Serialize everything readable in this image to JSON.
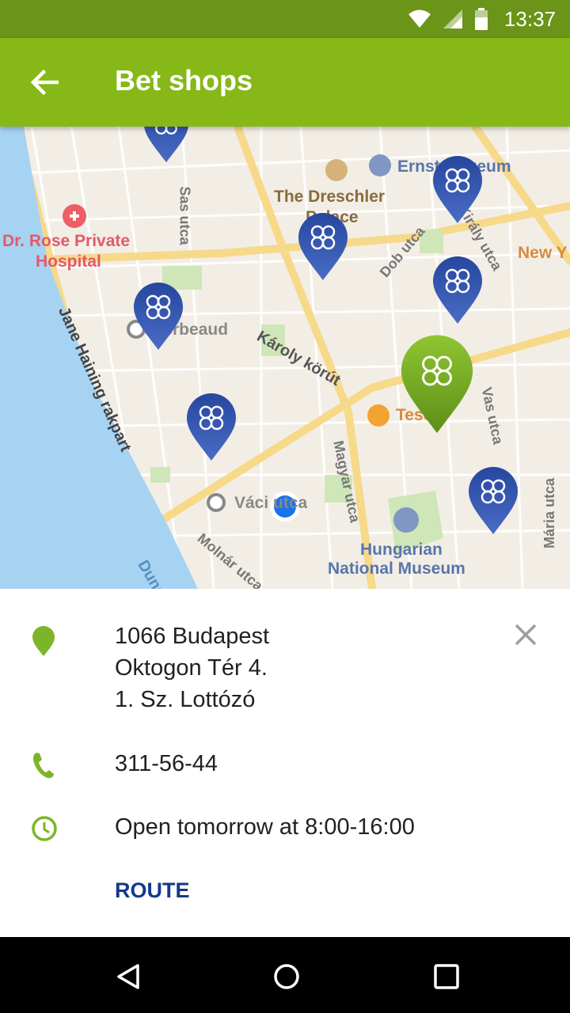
{
  "status_bar": {
    "time": "13:37"
  },
  "app_bar": {
    "title": "Bet shops"
  },
  "map": {
    "labels": {
      "hospital": "Dr. Rose Private",
      "hospital2": "Hospital",
      "dreschler": "The Dreschler",
      "palace": "Palace",
      "ernst": "Ernst Múzeum",
      "new_york": "New Y",
      "sas": "Sas utca",
      "dob": "Dob utca",
      "kiraly": "Király utca",
      "jane": "Jane Haining rakpart",
      "karoly": "Károly körút",
      "magyar": "Magyar utca",
      "vas": "Vas utca",
      "maria": "Mária utca",
      "molnar": "Molnár utca",
      "vaci": "Váci utca",
      "museum1": "Hungarian",
      "museum2": "National Museum",
      "tesco": "Tesco",
      "gerbeaud": "Gerbeaud",
      "duna": "Duna"
    }
  },
  "details": {
    "address_line1": "1066 Budapest",
    "address_line2": "Oktogon Tér 4.",
    "address_line3": "1. Sz. Lottózó",
    "phone": "311-56-44",
    "hours": "Open tomorrow at 8:00-16:00",
    "route_label": "ROUTE"
  },
  "icons": {
    "back": "arrow-left",
    "location": "map-pin",
    "phone": "phone",
    "clock": "clock",
    "close": "close-x",
    "shop_pin": "clover-pin"
  },
  "colors": {
    "status_bar": "#6a9518",
    "app_bar": "#86b817",
    "accent_green": "#7db52a",
    "pin_blue": "#26449a",
    "route_blue": "#123a8a",
    "water": "#a7d3f2"
  }
}
